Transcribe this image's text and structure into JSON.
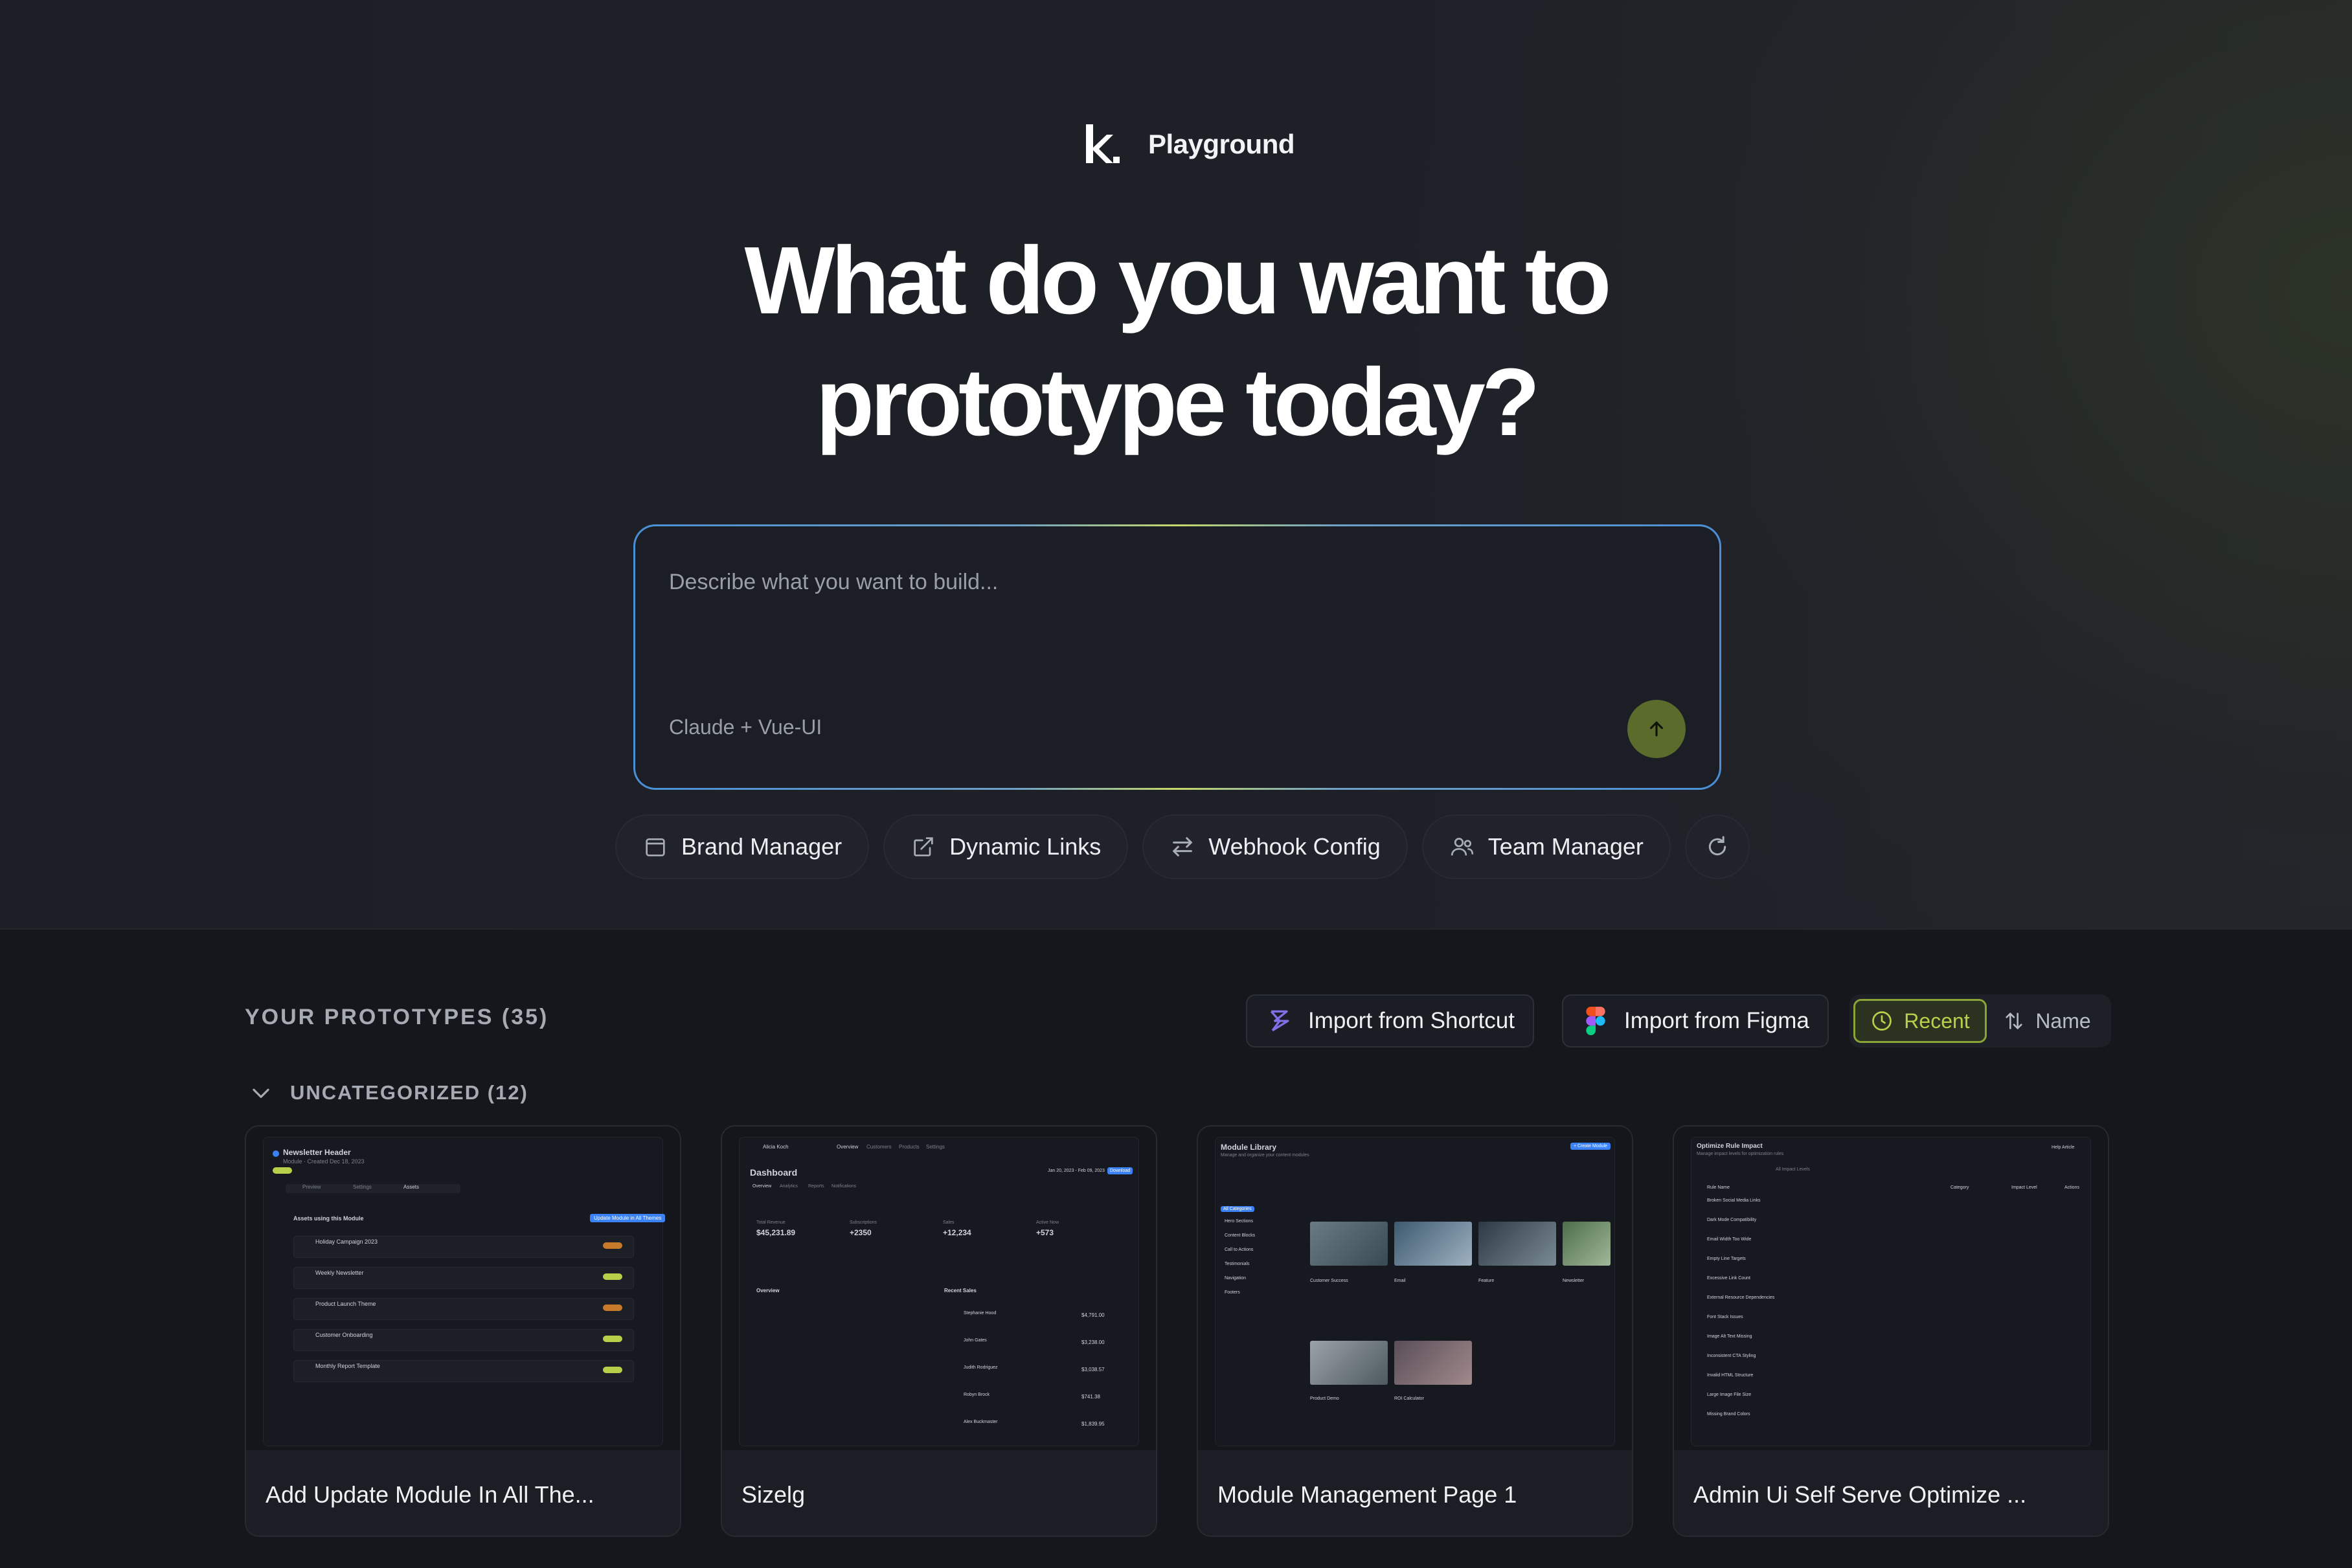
{
  "brand": {
    "name": "Playground"
  },
  "headline": {
    "line1": "What do you want to",
    "line2": "prototype today?"
  },
  "prompt": {
    "placeholder": "Describe what you want to build...",
    "model": "Claude + Vue-UI"
  },
  "suggestions": [
    {
      "label": "Brand Manager",
      "icon": "calendar-icon"
    },
    {
      "label": "Dynamic Links",
      "icon": "external-link-icon"
    },
    {
      "label": "Webhook Config",
      "icon": "swap-arrows-icon"
    },
    {
      "label": "Team Manager",
      "icon": "users-icon"
    }
  ],
  "prototypes": {
    "title": "YOUR PROTOTYPES (35)",
    "import_shortcut": "Import from Shortcut",
    "import_figma": "Import from Figma",
    "sort_recent": "Recent",
    "sort_name": "Name",
    "group_label": "UNCATEGORIZED (12)",
    "cards": [
      {
        "title": "Add Update Module In All The..."
      },
      {
        "title": "Sizelg"
      },
      {
        "title": "Module Management Page 1"
      },
      {
        "title": "Admin Ui Self Serve Optimize ..."
      }
    ]
  },
  "thumbs": {
    "newsletter": {
      "title": "Newsletter Header",
      "sub": "Module · Created Dec 18, 2023",
      "tabs": [
        "Preview",
        "Settings",
        "Assets"
      ],
      "heading": "Assets using this Module",
      "button": "Update Module in All Themes",
      "rows": [
        "Holiday Campaign 2023",
        "Weekly Newsletter",
        "Product Launch Theme",
        "Customer Onboarding",
        "Monthly Report Template"
      ]
    },
    "dashboard": {
      "title": "Dashboard",
      "user": "Alicia Koch",
      "nav": [
        "Overview",
        "Customers",
        "Products",
        "Settings"
      ],
      "date": "Jan 20, 2023 - Feb 09, 2023",
      "download": "Download",
      "tabs": [
        "Overview",
        "Analytics",
        "Reports",
        "Notifications"
      ],
      "stats": [
        {
          "label": "Total Revenue",
          "value": "$45,231.89"
        },
        {
          "label": "Subscriptions",
          "value": "+2350"
        },
        {
          "label": "Sales",
          "value": "+12,234"
        },
        {
          "label": "Active Now",
          "value": "+573"
        }
      ],
      "overview": "Overview",
      "recent": "Recent Sales",
      "sales": [
        {
          "name": "Stephanie Hood",
          "amount": "$4,791.00"
        },
        {
          "name": "John Gates",
          "amount": "$3,238.00"
        },
        {
          "name": "Judith Rodriguez",
          "amount": "$3,038.57"
        },
        {
          "name": "Robyn Brock",
          "amount": "$741.38"
        },
        {
          "name": "Alex Buckmaster",
          "amount": "$1,839.95"
        }
      ]
    },
    "library": {
      "title": "Module Library",
      "sub": "Manage and organize your content modules",
      "button": "+ Create Module",
      "categories": [
        "All Categories",
        "Hero Sections",
        "Content Blocks",
        "Call to Actions",
        "Testimonials",
        "Navigation",
        "Footers"
      ],
      "items": [
        "Customer Success",
        "Email",
        "Feature",
        "Newsletter",
        "Product Demo",
        "ROI Calculator"
      ]
    },
    "rules": {
      "title": "Optimize Rule Impact",
      "sub": "Manage impact levels for optimization rules",
      "help": "Help Article",
      "filter": "All Impact Levels",
      "cols": [
        "Rule Name",
        "Category",
        "Impact Level",
        "Actions"
      ],
      "rows": [
        "Broken Social Media Links",
        "Dark Mode Compatibility",
        "Email Width Too Wide",
        "Empty Line Targets",
        "Excessive Link Count",
        "External Resource Dependencies",
        "Font Stack Issues",
        "Image Alt Text Missing",
        "Inconsistent CTA Styling",
        "Invalid HTML Structure",
        "Large Image File Size",
        "Missing Brand Colors"
      ]
    }
  }
}
